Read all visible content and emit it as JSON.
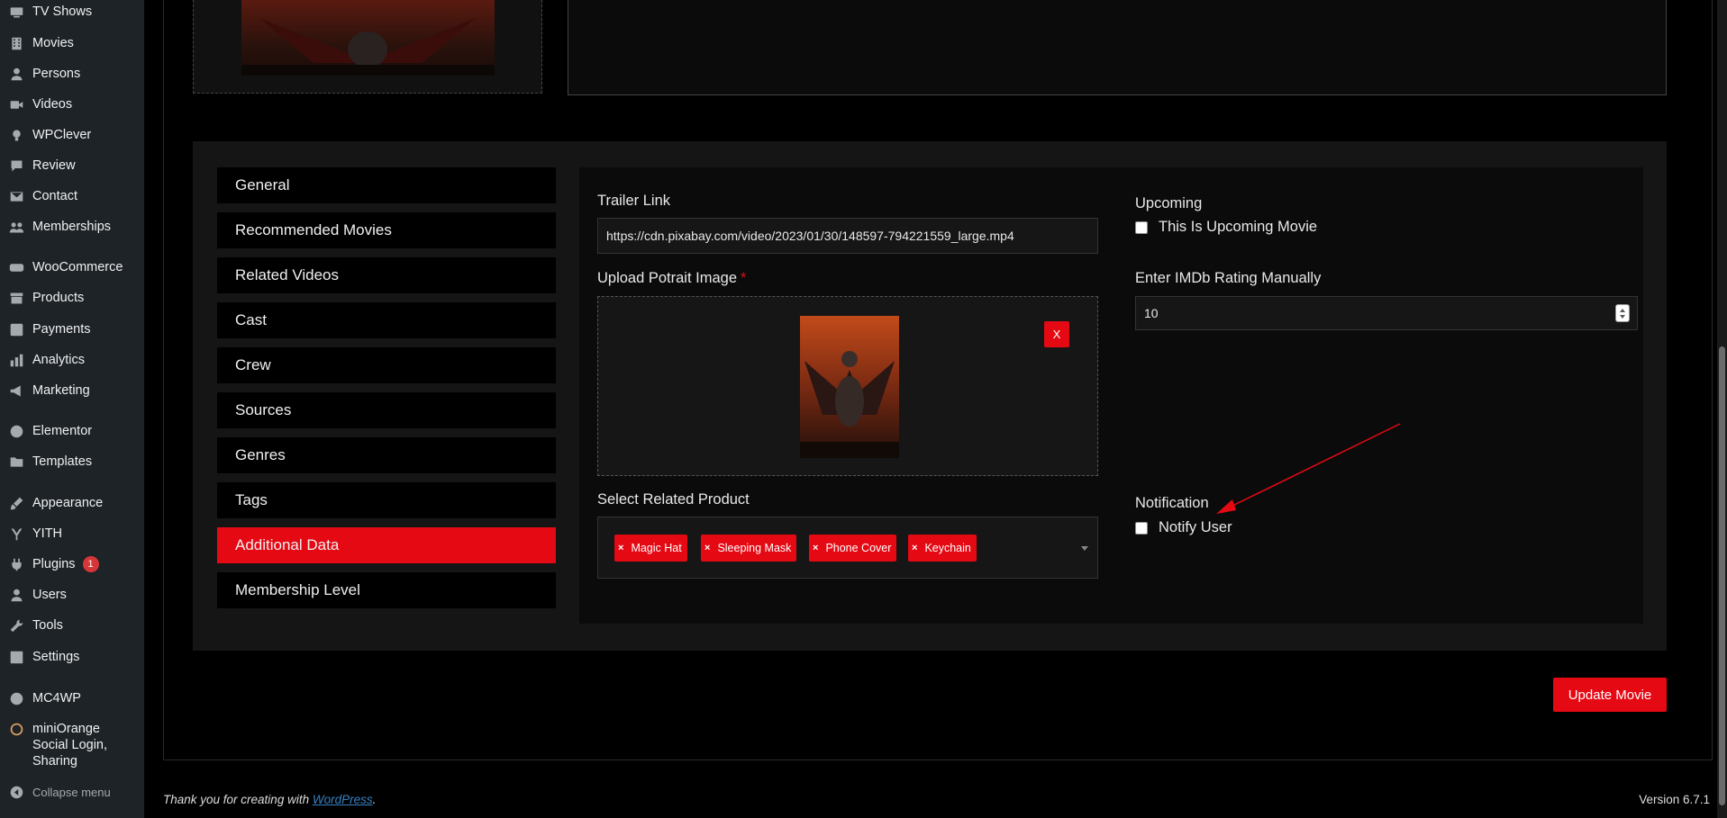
{
  "sidebar": {
    "items": [
      {
        "label": "TV Shows",
        "icon": "tv-icon",
        "badge": ""
      },
      {
        "label": "Movies",
        "icon": "film-icon",
        "badge": ""
      },
      {
        "label": "Persons",
        "icon": "person-icon",
        "badge": ""
      },
      {
        "label": "Videos",
        "icon": "video-camera-icon",
        "badge": ""
      },
      {
        "label": "WPClever",
        "icon": "lightbulb-icon",
        "badge": ""
      },
      {
        "label": "Review",
        "icon": "speech-bubble-icon",
        "badge": ""
      },
      {
        "label": "Contact",
        "icon": "envelope-icon",
        "badge": ""
      },
      {
        "label": "Memberships",
        "icon": "group-icon",
        "badge": ""
      },
      {
        "label": "WooCommerce",
        "icon": "woo-icon",
        "badge": ""
      },
      {
        "label": "Products",
        "icon": "archive-icon",
        "badge": ""
      },
      {
        "label": "Payments",
        "icon": "dollar-icon",
        "badge": ""
      },
      {
        "label": "Analytics",
        "icon": "bar-chart-icon",
        "badge": ""
      },
      {
        "label": "Marketing",
        "icon": "megaphone-icon",
        "badge": ""
      },
      {
        "label": "Elementor",
        "icon": "elementor-icon",
        "badge": ""
      },
      {
        "label": "Templates",
        "icon": "folder-icon",
        "badge": ""
      },
      {
        "label": "Appearance",
        "icon": "paintbrush-icon",
        "badge": ""
      },
      {
        "label": "YITH",
        "icon": "yith-icon",
        "badge": ""
      },
      {
        "label": "Plugins",
        "icon": "plug-icon",
        "badge": "1"
      },
      {
        "label": "Users",
        "icon": "user-icon",
        "badge": ""
      },
      {
        "label": "Tools",
        "icon": "wrench-icon",
        "badge": ""
      },
      {
        "label": "Settings",
        "icon": "sliders-icon",
        "badge": ""
      },
      {
        "label": "MC4WP",
        "icon": "mc4wp-icon",
        "badge": ""
      }
    ],
    "mini_orange": {
      "line1": "miniOrange",
      "line2": "Social Login,",
      "line3": "Sharing"
    },
    "collapse_label": "Collapse menu"
  },
  "tabs": [
    {
      "label": "General"
    },
    {
      "label": "Recommended Movies"
    },
    {
      "label": "Related Videos"
    },
    {
      "label": "Cast"
    },
    {
      "label": "Crew"
    },
    {
      "label": "Sources"
    },
    {
      "label": "Genres"
    },
    {
      "label": "Tags"
    },
    {
      "label": "Additional Data"
    },
    {
      "label": "Membership Level"
    }
  ],
  "active_tab": "Additional Data",
  "form": {
    "trailer_label": "Trailer Link",
    "trailer_value": "https://cdn.pixabay.com/video/2023/01/30/148597-794221559_large.mp4",
    "upload_label": "Upload Potrait Image",
    "required_mark": "*",
    "remove_label": "X",
    "related_label": "Select Related Product",
    "products": [
      "Magic Hat",
      "Sleeping Mask",
      "Phone Cover",
      "Keychain"
    ],
    "chip_remove": "×",
    "upcoming_label": "Upcoming",
    "upcoming_checkbox": "This Is Upcoming Movie",
    "upcoming_checked": false,
    "imdb_label": "Enter IMDb Rating Manually",
    "imdb_value": "10",
    "notification_label": "Notification",
    "notify_checkbox": "Notify User",
    "notify_checked": false
  },
  "update_button": "Update Movie",
  "footer": {
    "thanks_prefix": "Thank you for creating with ",
    "thanks_link": "WordPress",
    "thanks_suffix": ".",
    "version": "Version 6.7.1"
  },
  "colors": {
    "accent": "#e50914",
    "sidebar_bg": "#1d2327",
    "panel_bg": "#151515",
    "annotation": "#e50914"
  }
}
